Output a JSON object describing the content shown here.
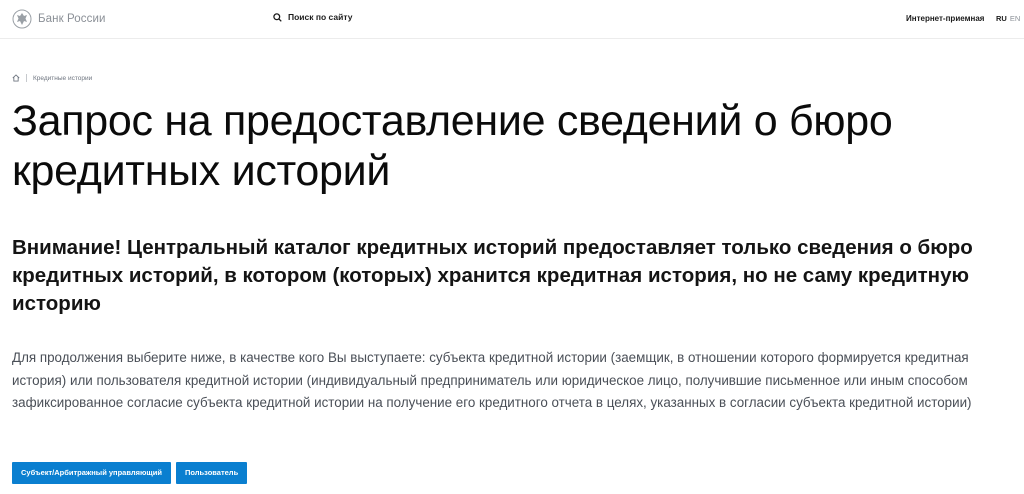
{
  "header": {
    "logo_text": "Банк России",
    "search_label": "Поиск по сайту",
    "reception_link": "Интернет-приемная",
    "lang_ru": "RU",
    "lang_en": "EN"
  },
  "breadcrumb": {
    "items": [
      "Кредитные истории"
    ]
  },
  "main": {
    "title": "Запрос на предоставление сведений о бюро кредитных историй",
    "warning": "Внимание! Центральный каталог кредитных историй предоставляет только сведения о бюро кредитных историй, в котором (которых) хранится кредитная история, но не саму кредитную историю",
    "instruction": "Для продолжения выберите ниже, в качестве кого Вы выступаете: субъекта кредитной истории (заемщик, в отношении которого формируется кредитная история) или пользователя кредитной истории (индивидуальный предприниматель или юридическое лицо, получившие письменное или иным способом зафиксированное согласие субъекта кредитной истории на получение его кредитного отчета в целях, указанных в согласии субъекта кредитной истории)",
    "buttons": {
      "subject": "Субъект/Арбитражный управляющий",
      "user": "Пользователь"
    }
  },
  "colors": {
    "accent": "#0a7fd0",
    "logo_text": "#8a8f96",
    "body_text": "#4a4f57"
  },
  "icons": {
    "logo": "bank-emblem-icon",
    "search": "search-icon",
    "home": "home-icon"
  }
}
